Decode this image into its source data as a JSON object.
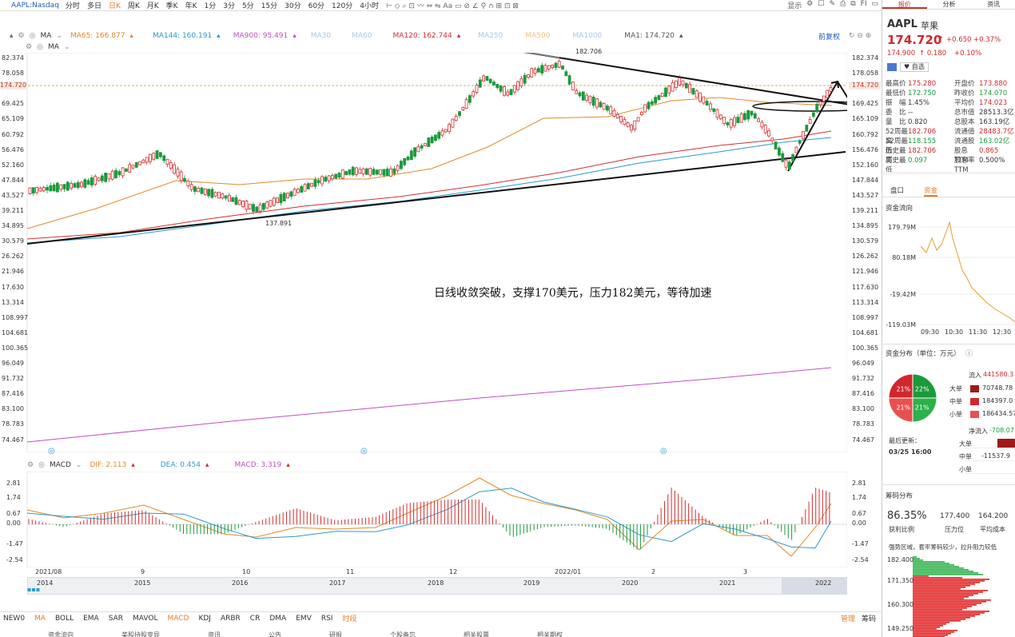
{
  "toolbar": {
    "symbol": "AAPL:Nasdaq",
    "periods": [
      "分时",
      "多日",
      "日K",
      "周K",
      "月K",
      "季K",
      "年K",
      "1分",
      "3分",
      "5分",
      "15分",
      "30分",
      "60分",
      "120分",
      "4小时"
    ],
    "active_period": "日K",
    "right_label": "显示"
  },
  "ma_legend": {
    "ma_label": "MA",
    "ma65": "MA65: 166.877",
    "ma144": "MA144: 160.191",
    "ma900": "MA900: 95.491",
    "ma30": "MA30",
    "ma60": "MA60",
    "ma120": "MA120: 162.744",
    "ma250": "MA250",
    "ma500": "MA500",
    "ma1000": "MA1000",
    "ma1": "MA1: 174.720",
    "adjust": "前复权"
  },
  "price_axis": {
    "labels": [
      "82.374",
      "78.058",
      "174.720",
      "69.425",
      "65.109",
      "60.792",
      "56.476",
      "52.160",
      "47.844",
      "43.527",
      "39.211",
      "34.895",
      "30.579",
      "26.262",
      "21.946",
      "17.630",
      "13.314",
      "108.997",
      "104.681",
      "100.365",
      "96.049",
      "91.732",
      "87.416",
      "83.100",
      "78.783",
      "74.467"
    ],
    "right_labels": [
      "182.374",
      "178.058",
      "174.720",
      "169.425",
      "165.109",
      "160.792",
      "156.476",
      "152.160",
      "147.844",
      "143.527",
      "139.211",
      "134.895",
      "130.579",
      "126.262",
      "121.946",
      "117.630",
      "113.314",
      "108.997",
      "104.681",
      "100.365",
      "96.049",
      "91.732",
      "87.416",
      "83.100",
      "78.783",
      "74.467"
    ],
    "current": "174.720"
  },
  "chart_annotations": {
    "high_label": "182.706",
    "low_label": "137.891",
    "note": "日线收敛突破，支撑170美元，压力182美元，等待加速"
  },
  "macd": {
    "label": "MACD",
    "dif": "DIF: 2.113",
    "dea": "DEA: 0.454",
    "macd": "MACD: 3.319",
    "axis": [
      "2.81",
      "1.74",
      "0.67",
      "0.00",
      "-1.47",
      "-2.54"
    ]
  },
  "time_axis": {
    "months": [
      "2021/08",
      "9",
      "10",
      "11",
      "12",
      "2022/01",
      "2",
      "3"
    ],
    "years": [
      "2014",
      "2015",
      "2016",
      "2017",
      "2018",
      "2019",
      "2020",
      "2021",
      "2022"
    ]
  },
  "indicators": [
    "NEW0",
    "MA",
    "BOLL",
    "EMA",
    "SAR",
    "MAVOL",
    "MACD",
    "KDJ",
    "ARBR",
    "CR",
    "DMA",
    "EMV",
    "RSI",
    "时段"
  ],
  "active_indicators": [
    "MA",
    "MACD",
    "时段"
  ],
  "indicator_right": [
    "管理",
    "筹码"
  ],
  "bottom_tabs": [
    "资金流向",
    "美股持股变异",
    "资讯",
    "公告",
    "研报",
    "个股备忘",
    "相关股票",
    "相关期权"
  ],
  "right_panel": {
    "tabs": [
      "报价",
      "分析",
      "资讯"
    ],
    "ticker": "AAPL",
    "name": "苹果",
    "price": "174.720",
    "change": "+0.650",
    "change_pct": "+0.37%",
    "after_price": "174.900",
    "after_change": "↑ 0.180",
    "after_pct": "+0.10%",
    "watch_label": "自选",
    "quote_rows": [
      [
        "最高价",
        "175.280",
        "开盘价",
        "173.880"
      ],
      [
        "最低价",
        "172.750",
        "昨收价",
        "174.070"
      ],
      [
        "振　幅",
        "1.45%",
        "平均价",
        "174.023"
      ],
      [
        "委　比",
        "--",
        "总市值",
        "28513.3亿"
      ],
      [
        "量　比",
        "0.820",
        "总股本",
        "163.19亿"
      ],
      [
        "52周最高",
        "182.706",
        "流通值",
        "28483.7亿"
      ],
      [
        "52周最低",
        "118.155",
        "流通股",
        "163.02亿"
      ],
      [
        "历史最高",
        "182.706",
        "股息TTM",
        "0.865"
      ],
      [
        "历史最低",
        "0.097",
        "股息率TTM",
        "0.500%"
      ]
    ],
    "sub_tabs": [
      "盘口",
      "资金"
    ],
    "active_sub_tab": "资金",
    "flow_title": "资金流向",
    "flow_axis": [
      "179.79M",
      "80.18M",
      "-19.42M",
      "-119.03M"
    ],
    "flow_times": [
      "09:30",
      "10:30",
      "11:30",
      "12:30",
      "1"
    ],
    "dist_title": "资金分布（单位：万元）",
    "pie": [
      {
        "label": "21%",
        "color": "#d0282e"
      },
      {
        "label": "22%",
        "color": "#1a9a3a"
      },
      {
        "label": "21%",
        "color": "#e85050"
      },
      {
        "label": "21%",
        "color": "#2db14a"
      }
    ],
    "inflow_label": "流入",
    "inflow_value": "441580.3",
    "inflow_rows": [
      [
        "大单",
        "70748.78"
      ],
      [
        "中单",
        "184397.0"
      ],
      [
        "小单",
        "186434.57"
      ]
    ],
    "updated_label": "最后更新：",
    "updated_time": "03/25 16:00",
    "net_label": "净流入",
    "net_value": "-708.07",
    "net_rows": [
      [
        "大单",
        ""
      ],
      [
        "中单",
        "-11537.9"
      ],
      [
        "小单",
        ""
      ]
    ],
    "chip_title": "筹码分布",
    "chip_profit": "86.35%",
    "chip_profit_label": "获利比例",
    "chip_pressure": "177.400",
    "chip_pressure_label": "压力位",
    "chip_cost": "164.200",
    "chip_cost_label": "平均成本",
    "chip_note": "强势区域，套牢筹码较少，拉升阻力较低",
    "chip_axis": [
      "182.400",
      "171.350",
      "160.300",
      "149.250"
    ]
  }
}
